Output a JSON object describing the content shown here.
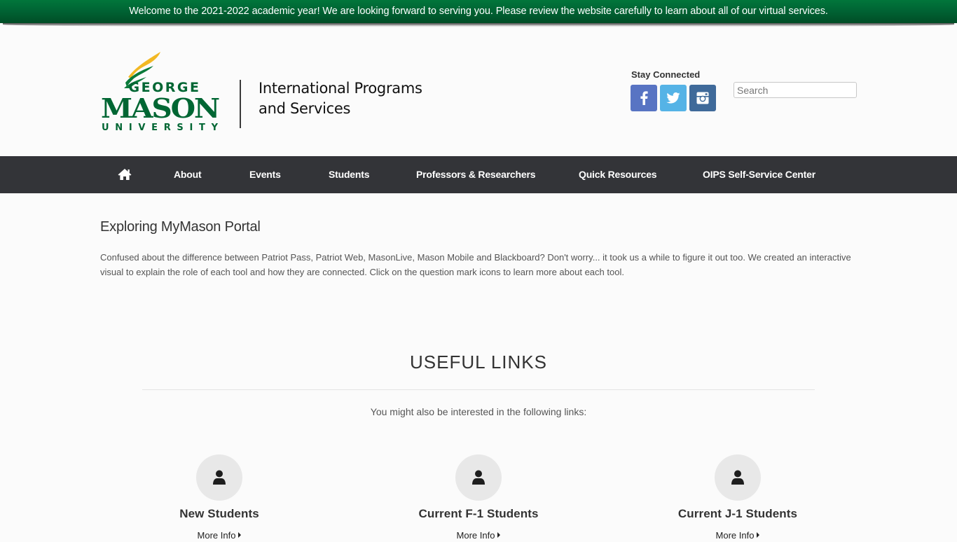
{
  "banner": {
    "text": "Welcome to the 2021-2022 academic year! We are looking forward to serving you. Please review the website carefully to learn about all of our virtual services."
  },
  "header": {
    "logo": {
      "line1": "GEORGE",
      "line2": "MASON",
      "line3": "UNIVERSITY",
      "alt": "George Mason University"
    },
    "dept_line1": "International Programs",
    "dept_line2": "and Services",
    "stay_connected": "Stay Connected",
    "social": [
      {
        "name": "facebook",
        "icon": "facebook-icon",
        "color": "#5874c3"
      },
      {
        "name": "twitter",
        "icon": "twitter-icon",
        "color": "#55b3e6"
      },
      {
        "name": "instagram",
        "icon": "instagram-icon",
        "color": "#3f6a9a"
      }
    ],
    "search": {
      "placeholder": "Search",
      "value": ""
    }
  },
  "nav": {
    "home_icon": "home-icon",
    "items": [
      {
        "label": "About"
      },
      {
        "label": "Events"
      },
      {
        "label": "Students"
      },
      {
        "label": "Professors & Researchers"
      },
      {
        "label": "Quick Resources"
      },
      {
        "label": "OIPS Self-Service Center"
      }
    ]
  },
  "content": {
    "title": "Exploring MyMason Portal",
    "intro": "Confused about the difference between Patriot Pass, Patriot Web, MasonLive, Mason Mobile and Blackboard?  Don't worry... it took us a while to figure it out too.  We created an interactive\nvisual to explain the role of each tool and how they are connected.  Click on the question mark icons to learn more about each tool."
  },
  "useful_links": {
    "title": "USEFUL LINKS",
    "subtitle": "You might also be interested in the following links:",
    "cards": [
      {
        "title": "New Students",
        "more": "More Info",
        "icon": "user-icon"
      },
      {
        "title": "Current F-1 Students",
        "more": "More Info",
        "icon": "user-icon"
      },
      {
        "title": "Current J-1 Students",
        "more": "More Info",
        "icon": "user-icon"
      }
    ]
  },
  "colors": {
    "banner_green": "#006233",
    "brand_green": "#006633",
    "brand_gold": "#ffcc33",
    "nav_bg": "#333438"
  }
}
